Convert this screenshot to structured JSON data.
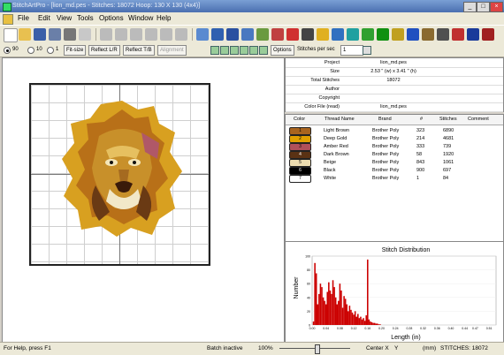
{
  "window": {
    "title": "StitchArtPro - [lion_md.pes - Stitches: 18072 Hoop: 130 X 130 (4x4)]",
    "controls": [
      "_",
      "□",
      "×"
    ]
  },
  "menu": [
    "File",
    "Edit",
    "View",
    "Tools",
    "Options",
    "Window",
    "Help"
  ],
  "toolbar2": {
    "zoom_options": [
      "90",
      "10",
      "1"
    ],
    "fit_label": "Fit-size",
    "reflect_lr": "Reflect L/R",
    "reflect_tb": "Reflect T/B",
    "alignment": "Alignment",
    "options_label": "Options",
    "stitches_per_sec_label": "Stitches per sec",
    "stitches_per_sec_value": "1"
  },
  "info": {
    "rows": [
      {
        "key": "Project",
        "value": "lion_md.pes"
      },
      {
        "key": "Size",
        "value": "2.53 \" (w) x 3.41 \" (h)"
      },
      {
        "key": "Total Stitches",
        "value": "18072"
      },
      {
        "key": "Author",
        "value": ""
      },
      {
        "key": "Copyright",
        "value": ""
      },
      {
        "key": "Color File (read)",
        "value": "lion_md.pes"
      }
    ]
  },
  "threads": {
    "headers": {
      "color": "Color",
      "name": "Thread Name",
      "brand": "Brand",
      "num": "#",
      "stitches": "Stitches",
      "comment": "Comment"
    },
    "rows": [
      {
        "idx": "1",
        "name": "Light Brown",
        "brand": "Brother Poly",
        "num": "323",
        "stitches": "6890",
        "color": "#a8641e"
      },
      {
        "idx": "2",
        "name": "Deep Gold",
        "brand": "Brother Poly",
        "num": "214",
        "stitches": "4681",
        "color": "#e0a000"
      },
      {
        "idx": "3",
        "name": "Amber Red",
        "brand": "Brother Poly",
        "num": "333",
        "stitches": "739",
        "color": "#b0505a"
      },
      {
        "idx": "4",
        "name": "Dark Brown",
        "brand": "Brother Poly",
        "num": "58",
        "stitches": "1920",
        "color": "#5a3214"
      },
      {
        "idx": "5",
        "name": "Beige",
        "brand": "Brother Poly",
        "num": "843",
        "stitches": "1061",
        "color": "#ecdcb0"
      },
      {
        "idx": "6",
        "name": "Black",
        "brand": "Brother Poly",
        "num": "900",
        "stitches": "697",
        "color": "#000000"
      },
      {
        "idx": "7",
        "name": "White",
        "brand": "Brother Poly",
        "num": "1",
        "stitches": "84",
        "color": "#ffffff"
      }
    ]
  },
  "chart_data": {
    "type": "bar",
    "title": "Stitch Distribution",
    "xlabel": "Length (in)",
    "ylabel": "Number",
    "x_ticks": [
      "0.00",
      "0.04",
      "0.08",
      "0.12",
      "0.16",
      "0.20",
      "0.24",
      "0.28",
      "0.32",
      "0.36",
      "0.40",
      "0.44",
      "0.47",
      "0.51"
    ],
    "y_ticks": [
      "0",
      "20",
      "40",
      "60",
      "80",
      "100"
    ],
    "ylim": [
      0,
      100
    ],
    "xlim": [
      0,
      0.53
    ],
    "bar_width": 0.004,
    "x": [
      0.004,
      0.008,
      0.012,
      0.016,
      0.02,
      0.024,
      0.028,
      0.032,
      0.036,
      0.04,
      0.044,
      0.048,
      0.052,
      0.056,
      0.06,
      0.064,
      0.068,
      0.072,
      0.076,
      0.08,
      0.084,
      0.088,
      0.092,
      0.096,
      0.1,
      0.104,
      0.108,
      0.112,
      0.116,
      0.12,
      0.124,
      0.128,
      0.132,
      0.136,
      0.14,
      0.144,
      0.148,
      0.152,
      0.156,
      0.16,
      0.164,
      0.168,
      0.172,
      0.176,
      0.18,
      0.184,
      0.188,
      0.192,
      0.196
    ],
    "values": [
      5,
      90,
      75,
      30,
      45,
      60,
      55,
      40,
      35,
      30,
      48,
      62,
      50,
      45,
      65,
      55,
      40,
      30,
      35,
      60,
      50,
      25,
      42,
      38,
      30,
      20,
      28,
      22,
      18,
      15,
      20,
      12,
      16,
      10,
      12,
      8,
      10,
      6,
      14,
      95,
      8,
      5,
      4,
      3,
      3,
      2,
      2,
      1,
      1
    ],
    "color": "#cc0000"
  },
  "status": {
    "help": "For Help, press F1",
    "batch": "Batch inactive",
    "zoom": "100%",
    "center_x": "Center X",
    "y": "Y",
    "units": "(mm)",
    "stitches": "STITCHES: 18072"
  }
}
